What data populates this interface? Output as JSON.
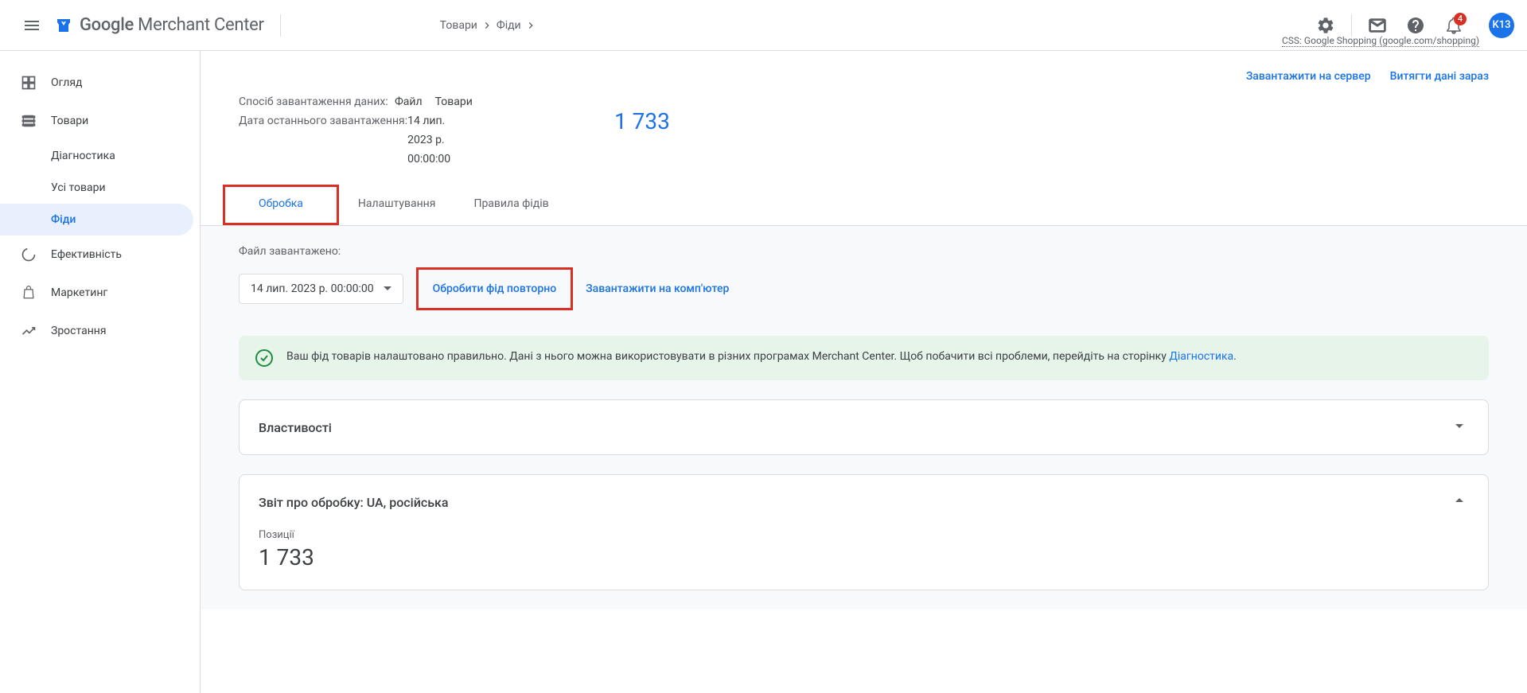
{
  "header": {
    "logo_text_bold": "Google",
    "logo_text_rest": " Merchant Center",
    "breadcrumb": [
      "Товари",
      "Фіди"
    ],
    "css_note": "CSS: Google Shopping (google.com/shopping)",
    "notifications_count": "4",
    "avatar": "K13"
  },
  "sidebar": {
    "overview": "Огляд",
    "products": "Товари",
    "diagnostics": "Діагностика",
    "all_products": "Усі товари",
    "feeds": "Фіди",
    "performance": "Ефективність",
    "marketing": "Маркетинг",
    "growth": "Зростання"
  },
  "actions": {
    "upload": "Завантажити на сервер",
    "fetch_now": "Витягти дані зараз"
  },
  "info": {
    "method_label": "Спосіб завантаження даних:",
    "method_value1": "Файл",
    "method_value2": "Товари",
    "last_upload_label": "Дата останнього завантаження:",
    "last_upload_date": "14 лип.",
    "last_upload_year": "2023 р.",
    "last_upload_time": "00:00:00",
    "float_number": "1 733"
  },
  "tabs": {
    "processing": "Обробка",
    "settings": "Налаштування",
    "rules": "Правила фідів"
  },
  "processing": {
    "file_uploaded_label": "Файл завантажено:",
    "dropdown_value": "14 лип. 2023 р. 00:00:00",
    "reprocess": "Обробити фід повторно",
    "download": "Завантажити на комп'ютер"
  },
  "banner": {
    "text_before": "Ваш фід товарів налаштовано правильно. Дані з нього можна використовувати в різних програмах Merchant Center. Щоб побачити всі проблеми, перейдіть на сторінку ",
    "link": "Діагностика",
    "text_after": "."
  },
  "accordion": {
    "properties": "Властивості",
    "report_title": "Звіт про обробку: UA, російська",
    "positions_label": "Позиції",
    "positions_value": "1 733"
  }
}
